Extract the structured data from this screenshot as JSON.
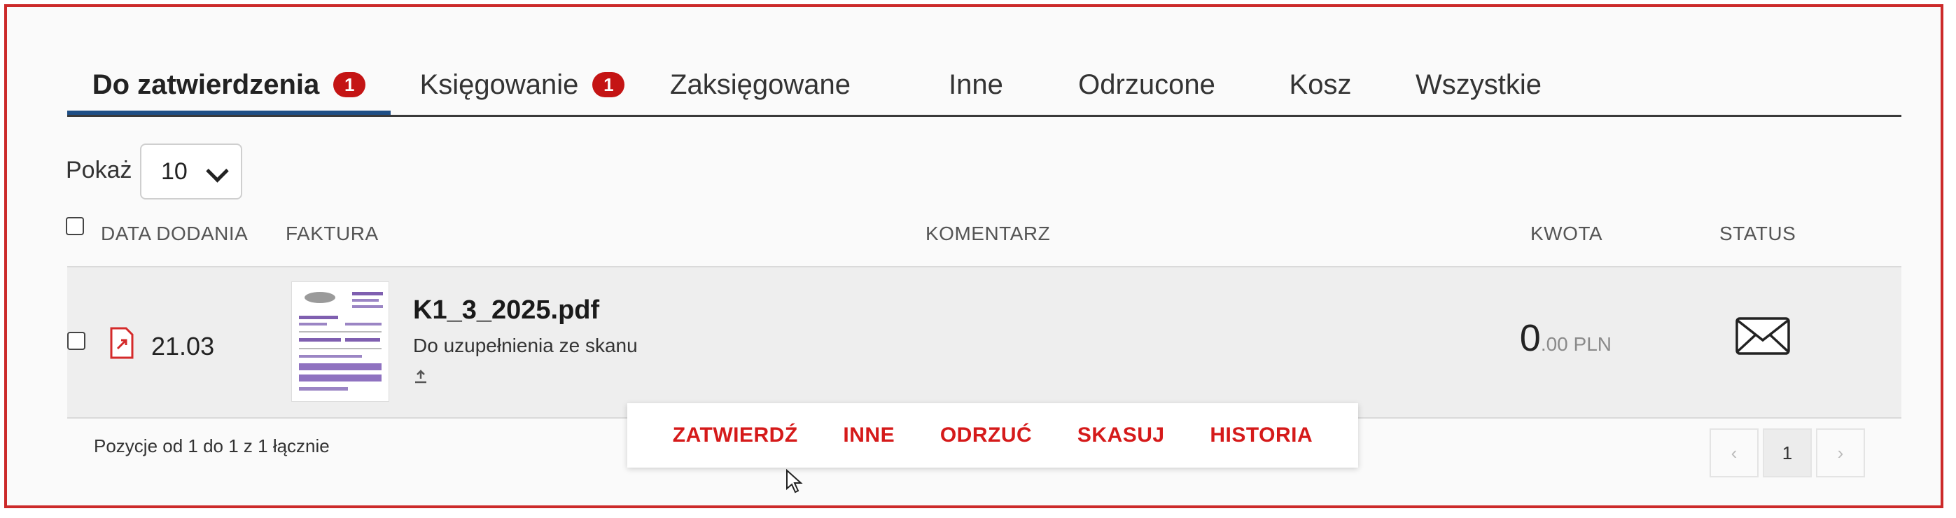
{
  "tabs": [
    {
      "label": "Do zatwierdzenia",
      "badge": "1",
      "active": true
    },
    {
      "label": "Księgowanie",
      "badge": "1",
      "active": false
    },
    {
      "label": "Zaksięgowane",
      "active": false
    },
    {
      "label": "Inne",
      "active": false
    },
    {
      "label": "Odrzucone",
      "active": false
    },
    {
      "label": "Kosz",
      "active": false
    },
    {
      "label": "Wszystkie",
      "active": false
    }
  ],
  "show": {
    "label": "Pokaż",
    "value": "10"
  },
  "columns": {
    "date": "DATA DODANIA",
    "invoice": "FAKTURA",
    "comment": "KOMENTARZ",
    "amount": "KWOTA",
    "status": "STATUS"
  },
  "row": {
    "date": "21.03",
    "file_name": "K1_3_2025.pdf",
    "note": "Do uzupełnienia ze skanu",
    "amount_int": "0",
    "amount_dec": ".00 PLN",
    "status_icon": "envelope-icon"
  },
  "footer": {
    "summary": "Pozycje od 1 do 1 z 1 łącznie"
  },
  "actions": [
    "ZATWIERDŹ",
    "INNE",
    "ODRZUĆ",
    "SKASUJ",
    "HISTORIA"
  ],
  "pagination": {
    "prev": "‹",
    "current": "1",
    "next": "›"
  },
  "colors": {
    "frame": "#cc2a2a",
    "badge": "#c41414",
    "accent": "#1f4f86",
    "action": "#d51a1a"
  }
}
